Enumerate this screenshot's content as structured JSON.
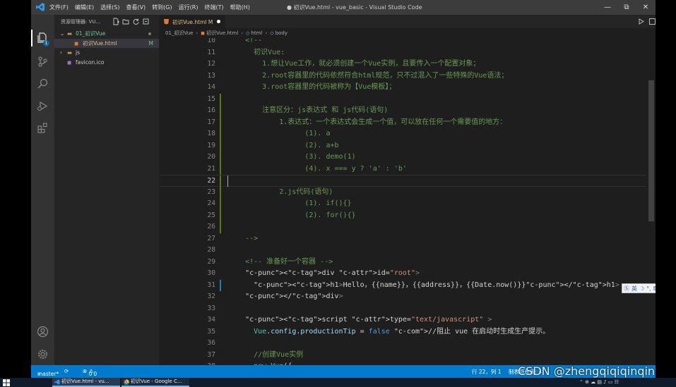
{
  "window": {
    "title": "● 初识Vue.html - vue_basic - Visual Studio Code",
    "menu": [
      "文件(F)",
      "编辑(E)",
      "选择(S)",
      "查看(V)",
      "转到(G)",
      "运行(R)",
      "终端(T)",
      "帮助(H)"
    ]
  },
  "activity": {
    "badge": "1"
  },
  "explorer": {
    "title": "资源管理器: VU...",
    "tree": [
      {
        "label": "01_初识Vue",
        "indent": 1,
        "type": "folder-open",
        "status": "dot"
      },
      {
        "label": "初识Vue.html",
        "indent": 2,
        "type": "file-html",
        "status": "M",
        "selected": true
      },
      {
        "label": "js",
        "indent": 1,
        "type": "folder-closed",
        "status": ""
      },
      {
        "label": "favicon.ico",
        "indent": 1,
        "type": "file-ico",
        "status": ""
      }
    ]
  },
  "tab": {
    "label": "初识Vue.html",
    "status": "M"
  },
  "breadcrumb": [
    "01_初识Vue",
    "初识Vue.html",
    "html",
    "body"
  ],
  "editor": {
    "current_line": "22",
    "lines": [
      {
        "n": "10",
        "text": "    <!--"
      },
      {
        "n": "11",
        "text": "      初识Vue:"
      },
      {
        "n": "12",
        "text": "        1.想让Vue工作，就必须创建一个Vue实例，且要传入一个配置对象；"
      },
      {
        "n": "13",
        "text": "        2.root容器里的代码依然符合html规范，只不过混入了一些特殊的Vue语法；"
      },
      {
        "n": "14",
        "text": "        3.root容器里的代码被称为【Vue模板】；"
      },
      {
        "n": "15",
        "text": ""
      },
      {
        "n": "16",
        "text": "        注意区分：js表达式 和 js代码(语句)"
      },
      {
        "n": "17",
        "text": "            1.表达式：一个表达式会生成一个值，可以放在任何一个需要值的地方："
      },
      {
        "n": "18",
        "text": "                  (1). a"
      },
      {
        "n": "19",
        "text": "                  (2). a+b"
      },
      {
        "n": "20",
        "text": "                  (3). demo(1)"
      },
      {
        "n": "21",
        "text": "                  (4). x === y ? 'a' : 'b'"
      },
      {
        "n": "22",
        "text": ""
      },
      {
        "n": "23",
        "text": "            2.js代码(语句)"
      },
      {
        "n": "24",
        "text": "                  (1). if(){}"
      },
      {
        "n": "25",
        "text": "                  (2). for(){}"
      },
      {
        "n": "26",
        "text": ""
      },
      {
        "n": "27",
        "text": "    -->"
      },
      {
        "n": "28",
        "text": ""
      },
      {
        "n": "29",
        "text": "    <!-- 准备好一个容器 -->"
      },
      {
        "n": "30",
        "text": "    <div id=\"root\">"
      },
      {
        "n": "31",
        "text": "      <h1>Hello，{{name}}，{{address}}，{{Date.now()}}</h1>"
      },
      {
        "n": "32",
        "text": "    </div>"
      },
      {
        "n": "33",
        "text": ""
      },
      {
        "n": "34",
        "text": "    <script type=\"text/javascript\" >"
      },
      {
        "n": "35",
        "text": "      Vue.config.productionTip = false //阻止 vue 在启动时生成生产提示。"
      },
      {
        "n": "36",
        "text": ""
      },
      {
        "n": "37",
        "text": "      //创建Vue实例"
      },
      {
        "n": "38",
        "text": "      new Vue({"
      }
    ]
  },
  "ime": {
    "label": "英"
  },
  "statusbar": {
    "branch": "master*",
    "errors": "0",
    "warnings": "0",
    "position": "行 22，列 1",
    "tab_setting": "制表符长度: 4"
  },
  "taskbar": {
    "tasks": [
      "初识Vue.html - vu...",
      "初识Vue - Google C..."
    ]
  },
  "watermark": "CSDN @zhengqiqiqinqin",
  "colors": {
    "accent": "#007acc",
    "comment": "#6a9955",
    "tag": "#569cd6",
    "string": "#ce9178",
    "attribute": "#9cdcfe"
  }
}
